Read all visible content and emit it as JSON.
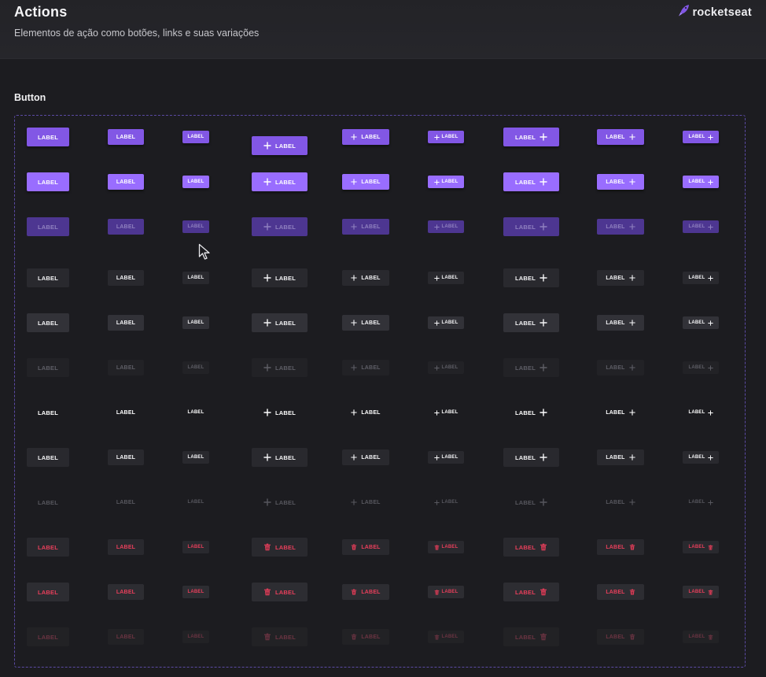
{
  "header": {
    "title": "Actions",
    "subtitle": "Elementos de ação como botões, links e suas variações"
  },
  "brand": {
    "name": "rocketseat",
    "logo_icon": "rocket-icon",
    "logo_color": "#8257e5"
  },
  "section": {
    "title": "Button"
  },
  "colors": {
    "background": "#1c1c20",
    "header_background": "#242428",
    "accent_purple": "#8257e5",
    "accent_purple_hover": "#996dff",
    "accent_purple_disabled": "#4d3691",
    "danger_red": "#e83f5b",
    "frame_border": "#5b4aa3"
  },
  "button_grid": {
    "label": "LABEL",
    "icons": {
      "add": "plus-icon",
      "danger": "trash-icon"
    },
    "column_variants": [
      {
        "size": "large",
        "icon": "none"
      },
      {
        "size": "medium",
        "icon": "none"
      },
      {
        "size": "small",
        "icon": "none"
      },
      {
        "size": "large",
        "icon": "leading"
      },
      {
        "size": "medium",
        "icon": "leading"
      },
      {
        "size": "small",
        "icon": "leading"
      },
      {
        "size": "large",
        "icon": "trailing"
      },
      {
        "size": "medium",
        "icon": "trailing"
      },
      {
        "size": "small",
        "icon": "trailing"
      }
    ],
    "row_variants": [
      {
        "type": "primary",
        "state": "default"
      },
      {
        "type": "primary",
        "state": "hover"
      },
      {
        "type": "primary",
        "state": "disabled"
      },
      {
        "type": "secondary",
        "state": "default"
      },
      {
        "type": "secondary",
        "state": "hover"
      },
      {
        "type": "secondary",
        "state": "disabled"
      },
      {
        "type": "tertiary",
        "state": "default"
      },
      {
        "type": "tertiary",
        "state": "hover"
      },
      {
        "type": "tertiary",
        "state": "disabled"
      },
      {
        "type": "danger",
        "state": "default"
      },
      {
        "type": "danger",
        "state": "hover"
      },
      {
        "type": "danger",
        "state": "disabled"
      }
    ]
  }
}
